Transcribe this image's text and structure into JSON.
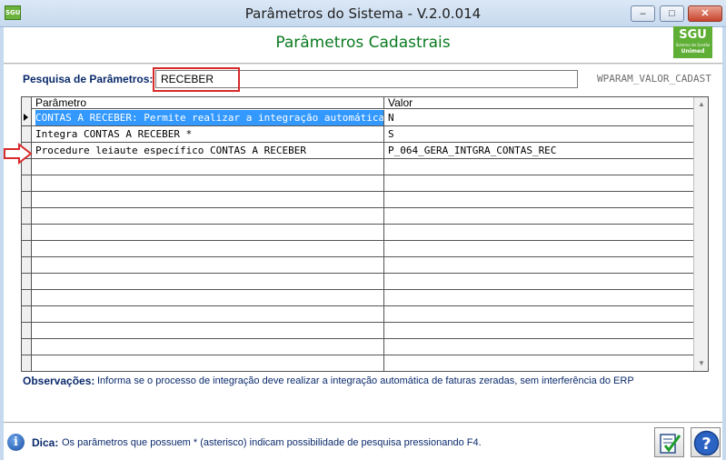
{
  "window": {
    "app_icon": "SGU",
    "title": "Parâmetros do Sistema - V.2.0.014",
    "minimize": "–",
    "maximize": "□",
    "close": "✕"
  },
  "header": {
    "title": "Parâmetros Cadastrais",
    "brand_main": "SGU",
    "brand_sub": "Sistema de Gestão",
    "brand_org": "Unimed"
  },
  "search": {
    "label": "Pesquisa de Parâmetros:",
    "value": "RECEBER",
    "field_code": "WPARAM_VALOR_CADAST"
  },
  "grid": {
    "columns": [
      "Parâmetro",
      "Valor"
    ],
    "rows": [
      {
        "param": "CONTAS A RECEBER: Permite realizar a integração automática",
        "valor": "N",
        "selected": true
      },
      {
        "param": "Integra CONTAS A RECEBER *",
        "valor": "S",
        "selected": false
      },
      {
        "param": "Procedure leiaute específico CONTAS A RECEBER",
        "valor": "P_064_GERA_INTGRA_CONTAS_REC",
        "selected": false
      }
    ],
    "empty_rows": 13,
    "scroll_up": "▲",
    "scroll_down": "▼"
  },
  "observations": {
    "label": "Observações:",
    "text": "Informa se o processo de integração deve realizar a integração automática de faturas zeradas, sem interferência do ERP"
  },
  "footer": {
    "info_icon": "i",
    "tip_label": "Dica:",
    "tip_text": "Os parâmetros que possuem * (asterisco) indicam possibilidade de pesquisa pressionando F4."
  },
  "colors": {
    "header_green": "#0a7a1f",
    "label_blue": "#0a2a6b",
    "selection": "#3399ff",
    "highlight_red": "#d82a2a"
  },
  "icons": [
    "app-logo-icon",
    "minimize-icon",
    "maximize-icon",
    "close-icon",
    "row-pointer-icon",
    "red-arrow-icon",
    "info-icon",
    "confirm-icon",
    "help-icon"
  ]
}
